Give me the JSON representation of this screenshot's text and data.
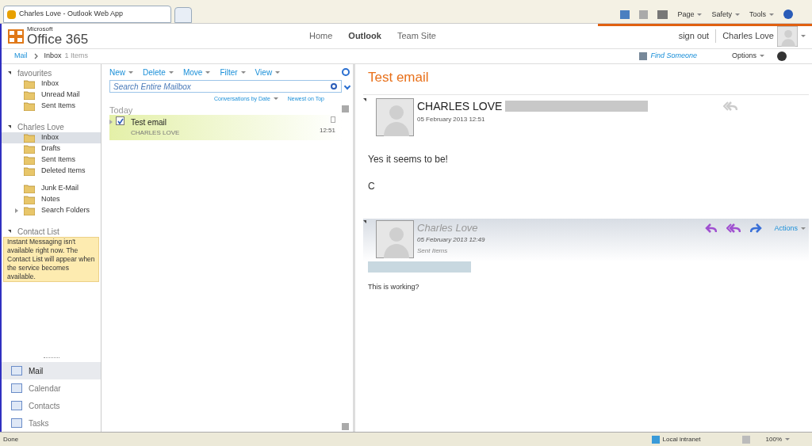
{
  "browser": {
    "tab_title": "Charles Love - Outlook Web App",
    "tools": [
      "Page",
      "Safety",
      "Tools"
    ],
    "status": "Done",
    "zone": "Local intranet",
    "zoom": "100%"
  },
  "header": {
    "logo_small": "Microsoft",
    "logo": "Office 365",
    "nav": [
      {
        "label": "Home",
        "selected": false
      },
      {
        "label": "Outlook",
        "selected": true
      },
      {
        "label": "Team Site",
        "selected": false
      }
    ],
    "sign_out": "sign out",
    "user": "Charles Love"
  },
  "breadcrumb": {
    "root": "Mail",
    "current": "Inbox",
    "count": "1 Items",
    "find": "Find Someone",
    "options": "Options"
  },
  "folders": [
    {
      "title": "favourites",
      "items": [
        {
          "label": "Inbox",
          "selected": false,
          "collapsed": false
        },
        {
          "label": "Unread Mail",
          "selected": false,
          "collapsed": false
        },
        {
          "label": "Sent Items",
          "selected": false,
          "collapsed": false
        }
      ]
    },
    {
      "title": "Charles Love",
      "items": [
        {
          "label": "Inbox",
          "selected": true,
          "collapsed": false
        },
        {
          "label": "Drafts",
          "selected": false,
          "collapsed": false
        },
        {
          "label": "Sent Items",
          "selected": false,
          "collapsed": false
        },
        {
          "label": "Deleted Items",
          "selected": false,
          "collapsed": false
        },
        {
          "label": "Junk E-Mail",
          "selected": false,
          "collapsed": false
        },
        {
          "label": "Notes",
          "selected": false,
          "collapsed": false
        },
        {
          "label": "Search Folders",
          "selected": false,
          "collapsed": true
        }
      ]
    }
  ],
  "contact_list": {
    "title": "Contact List",
    "notice": "Instant Messaging isn't available right now. The Contact List will appear when the service becomes available."
  },
  "modules": [
    {
      "label": "Mail",
      "selected": true
    },
    {
      "label": "Calendar",
      "selected": false
    },
    {
      "label": "Contacts",
      "selected": false
    },
    {
      "label": "Tasks",
      "selected": false
    }
  ],
  "list": {
    "actions": [
      "New",
      "Delete",
      "Move",
      "Filter",
      "View"
    ],
    "search": {
      "placeholder": "Search Entire Mailbox"
    },
    "sort": "Conversations by Date",
    "order": "Newest on Top",
    "group": "Today",
    "messages": [
      {
        "subject": "Test email",
        "sender": "CHARLES LOVE",
        "time": "12:51",
        "selected": true,
        "checked": true
      }
    ]
  },
  "reading": {
    "subject": "Test email",
    "messages": [
      {
        "kind": "latest",
        "sender": "CHARLES LOVE",
        "date": "05 February 2013 12:51",
        "body": [
          "Yes it seems to be!",
          "C"
        ]
      },
      {
        "kind": "earlier",
        "sender": "Charles Love",
        "date": "05 February 2013 12:49",
        "folder": "Sent Items",
        "actions": "Actions",
        "body": [
          "This is working?"
        ]
      }
    ]
  }
}
